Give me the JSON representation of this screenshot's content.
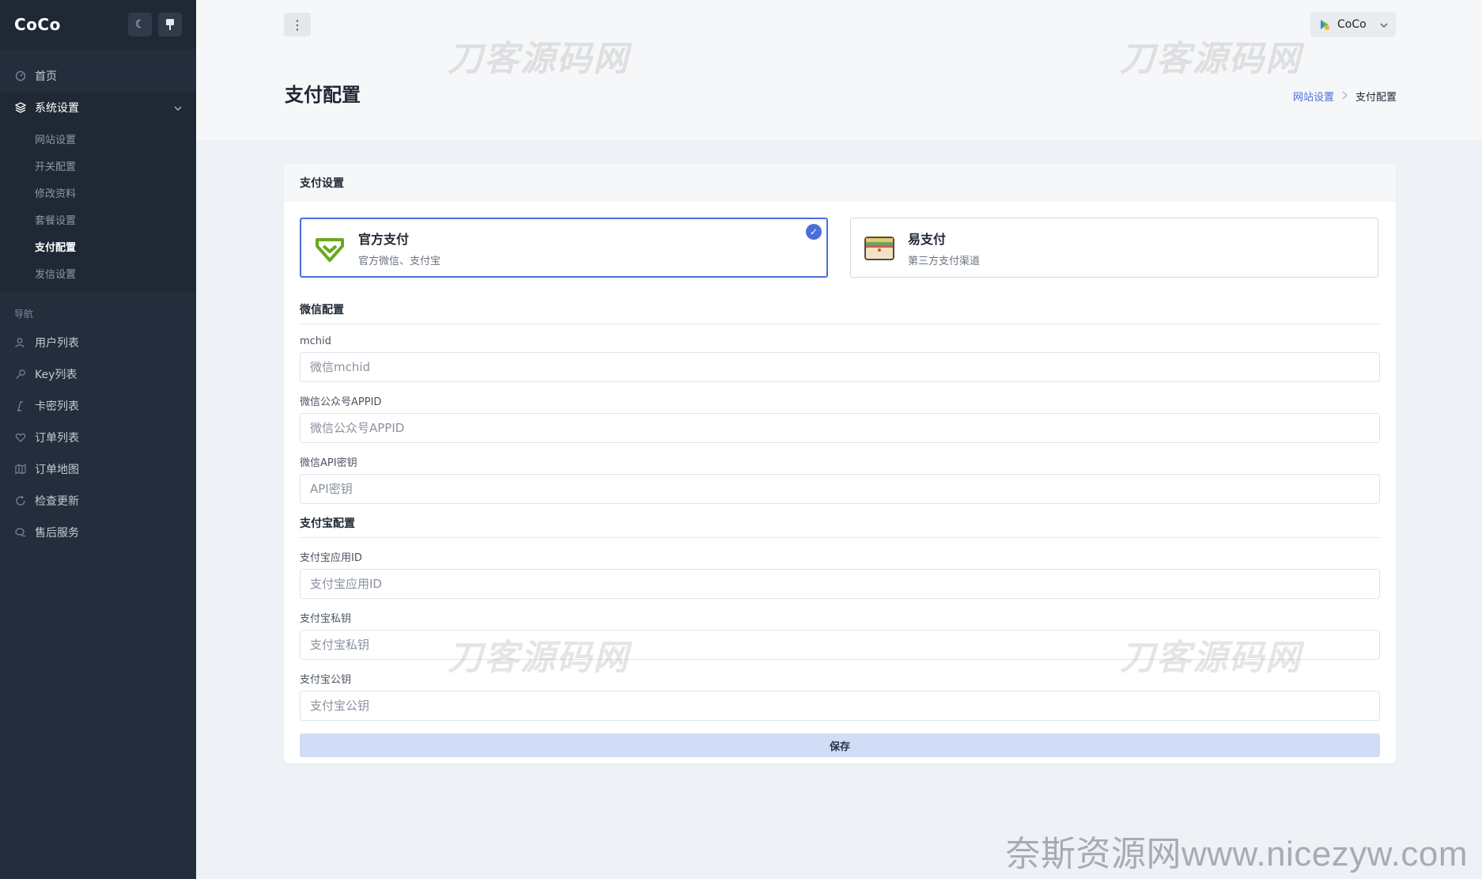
{
  "brand": {
    "name": "CoCo"
  },
  "sidebar": {
    "top_items": [
      {
        "label": "首页"
      }
    ],
    "group": {
      "label": "系统设置",
      "children": [
        {
          "label": "网站设置"
        },
        {
          "label": "开关配置"
        },
        {
          "label": "修改资料"
        },
        {
          "label": "套餐设置"
        },
        {
          "label": "支付配置",
          "active": true
        },
        {
          "label": "发信设置"
        }
      ]
    },
    "section_label": "导航",
    "nav_items": [
      {
        "label": "用户列表",
        "icon": "users-icon"
      },
      {
        "label": "Key列表",
        "icon": "key-icon"
      },
      {
        "label": "卡密列表",
        "icon": "card-icon"
      },
      {
        "label": "订单列表",
        "icon": "heart-icon"
      },
      {
        "label": "订单地图",
        "icon": "map-icon"
      },
      {
        "label": "检查更新",
        "icon": "refresh-icon"
      },
      {
        "label": "售后服务",
        "icon": "chat-icon"
      }
    ]
  },
  "header": {
    "user_name": "CoCo"
  },
  "page": {
    "title": "支付配置",
    "breadcrumb": {
      "parent": "网站设置",
      "current": "支付配置"
    }
  },
  "card": {
    "title": "支付设置",
    "pay_options": [
      {
        "title": "官方支付",
        "desc": "官方微信、支付宝"
      },
      {
        "title": "易支付",
        "desc": "第三方支付渠道"
      }
    ],
    "wechat": {
      "section": "微信配置",
      "mchid_label": "mchid",
      "mchid_placeholder": "微信mchid",
      "appid_label": "微信公众号APPID",
      "appid_placeholder": "微信公众号APPID",
      "key_label": "微信API密钥",
      "key_placeholder": "API密钥"
    },
    "alipay": {
      "section": "支付宝配置",
      "appid_label": "支付宝应用ID",
      "appid_placeholder": "支付宝应用ID",
      "private_label": "支付宝私钥",
      "private_placeholder": "支付宝私钥",
      "public_label": "支付宝公钥",
      "public_placeholder": "支付宝公钥"
    },
    "save_label": "保存"
  },
  "watermarks": {
    "overlay": "刀客源码网",
    "footer": "奈斯资源网www.nicezyw.com"
  },
  "colors": {
    "sidebar_bg": "#232d3b",
    "accent": "#4a6fd8",
    "save_bg": "#d1dcf6"
  }
}
